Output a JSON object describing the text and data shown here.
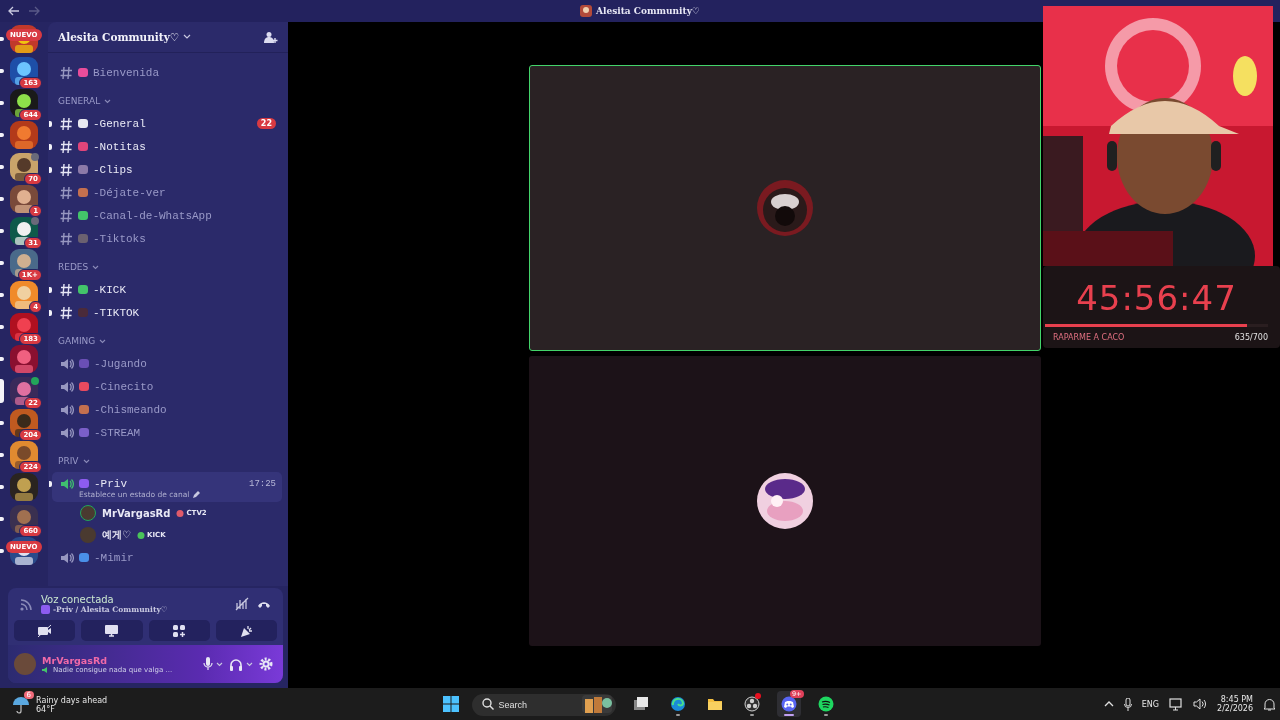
{
  "titlebar": {
    "title": "Alesita Community♡"
  },
  "servers": [
    {
      "badge": {
        "text": "NUEVO",
        "kind": "new"
      },
      "unread": true,
      "selected": false
    },
    {
      "badge": {
        "text": "163",
        "kind": "count"
      },
      "unread": true,
      "selected": false
    },
    {
      "badge": {
        "text": "644",
        "kind": "count"
      },
      "unread": true,
      "selected": false
    },
    {
      "unread": true,
      "selected": false
    },
    {
      "badge": {
        "text": "70",
        "kind": "count"
      },
      "unread": true,
      "selected": false,
      "indicator": {
        "kind": "speaker"
      }
    },
    {
      "badge": {
        "text": "1",
        "kind": "count"
      },
      "unread": true,
      "selected": false
    },
    {
      "badge": {
        "text": "31",
        "kind": "count"
      },
      "unread": true,
      "selected": false,
      "indicator": {
        "kind": "chat"
      }
    },
    {
      "badge": {
        "text": "1K+",
        "kind": "count"
      },
      "unread": true,
      "selected": false
    },
    {
      "badge": {
        "text": "4",
        "kind": "count"
      },
      "unread": true,
      "selected": false
    },
    {
      "badge": {
        "text": "183",
        "kind": "count"
      },
      "unread": true,
      "selected": false
    },
    {
      "unread": true,
      "selected": false
    },
    {
      "badge": {
        "text": "22",
        "kind": "count"
      },
      "unread": false,
      "selected": true,
      "indicator": {
        "kind": "voice"
      }
    },
    {
      "badge": {
        "text": "204",
        "kind": "count"
      },
      "unread": true,
      "selected": false
    },
    {
      "badge": {
        "text": "224",
        "kind": "count"
      },
      "unread": true,
      "selected": false
    },
    {
      "unread": true,
      "selected": false
    },
    {
      "badge": {
        "text": "660",
        "kind": "count"
      },
      "unread": true,
      "selected": false
    },
    {
      "badge": {
        "text": "NUEVO",
        "kind": "new"
      },
      "unread": true,
      "selected": false
    }
  ],
  "server_header": {
    "name": "Alesita Community♡"
  },
  "sections": [
    {
      "channels": [
        {
          "kind": "text",
          "name": "Bienvenida",
          "color": "#e94d9b",
          "unread": false
        }
      ]
    },
    {
      "label": "GENERAL",
      "channels": [
        {
          "kind": "text",
          "name": "-General",
          "color": "#e8e8f0",
          "unread": true,
          "badge": "22"
        },
        {
          "kind": "text",
          "name": "-Notitas",
          "color": "#e0457a",
          "unread": true
        },
        {
          "kind": "text",
          "name": "-Clips",
          "color": "#8c7aa8",
          "unread": true
        },
        {
          "kind": "text",
          "name": "-Déjate-ver",
          "color": "#c4704f",
          "unread": false
        },
        {
          "kind": "text",
          "name": "-Canal-de-WhatsApp",
          "color": "#43c46a",
          "unread": false
        },
        {
          "kind": "text",
          "name": "-Tiktoks",
          "color": "#6b6170",
          "unread": false
        }
      ]
    },
    {
      "label": "REDES",
      "channels": [
        {
          "kind": "text",
          "name": "-KICK",
          "color": "#43c46a",
          "unread": true
        },
        {
          "kind": "text",
          "name": "-TIKTOK",
          "color": "#4a2a3a",
          "unread": true
        }
      ]
    },
    {
      "label": "GAMING",
      "channels": [
        {
          "kind": "voice",
          "name": "-Jugando",
          "color": "#6a4fb5",
          "unread": false
        },
        {
          "kind": "voice",
          "name": "-Cinecito",
          "color": "#e84a5f",
          "unread": false
        },
        {
          "kind": "voice",
          "name": "-Chismeando",
          "color": "#c4704f",
          "unread": false
        },
        {
          "kind": "voice",
          "name": "-STREAM",
          "color": "#7a5fc8",
          "unread": false
        }
      ]
    },
    {
      "label": "PRIV",
      "channels": [
        {
          "kind": "voice",
          "name": "-Priv",
          "color": "#8d5cf0",
          "unread": true,
          "selected": true,
          "time": "17:25",
          "status": "Establece un estado de canal",
          "users": [
            {
              "name": "MrVargasRd",
              "tag": "CTV2",
              "speaking": true
            },
            {
              "name": "예게♡",
              "tag": "KICK",
              "speaking": false
            }
          ]
        },
        {
          "kind": "voice",
          "name": "-Mimir",
          "color": "#4a8fe8",
          "unread": false,
          "selected": false
        }
      ]
    }
  ],
  "voice_panel": {
    "title": "Voz conectada",
    "channel": "-Priv / Alesita Community♡"
  },
  "user_panel": {
    "name": "MrVargasRd",
    "status": "Nadie consigue nada que valga ..."
  },
  "tiles": [
    {
      "speaking": true
    },
    {
      "speaking": false
    }
  ],
  "overlay": {
    "timer": "45:56:47",
    "level": 0.907,
    "goal_label": "RAPARME A CACO",
    "goal_count": "635/700"
  },
  "taskbar": {
    "weather": {
      "badge": "6",
      "title": "Rainy days ahead",
      "temp": "64°F"
    },
    "search": {
      "placeholder": "Search"
    },
    "apps": [
      {
        "kind": "taskview",
        "running": false,
        "selected": false
      },
      {
        "kind": "edge",
        "running": true,
        "selected": false
      },
      {
        "kind": "files",
        "running": false,
        "selected": false
      },
      {
        "kind": "obs",
        "running": true,
        "selected": false,
        "alert": true
      },
      {
        "kind": "discord",
        "running": true,
        "selected": true,
        "badge": "9+"
      },
      {
        "kind": "spotify",
        "running": true,
        "selected": false
      }
    ],
    "language": "ENG",
    "time": "8:45 PM",
    "date": "2/2/2026"
  }
}
